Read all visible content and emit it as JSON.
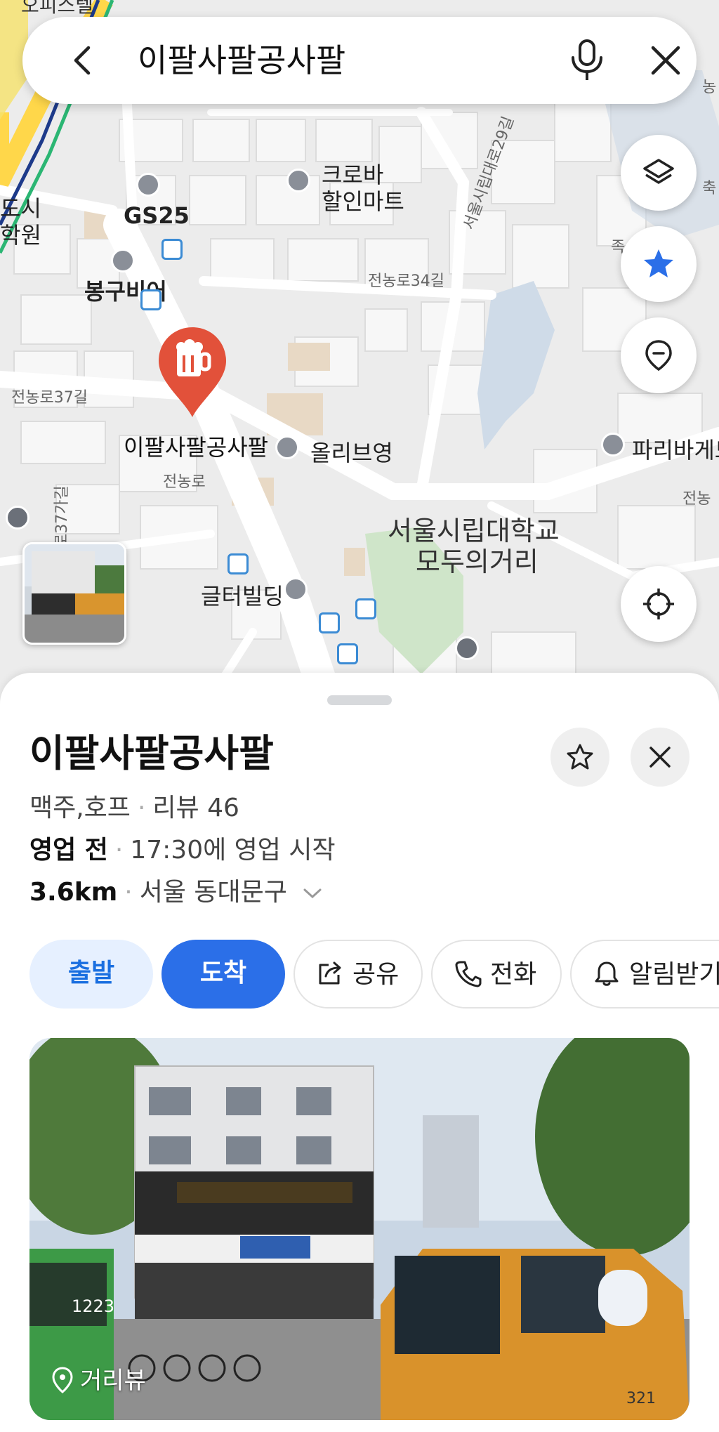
{
  "search": {
    "query": "이팔사팔공사팔"
  },
  "map": {
    "labels": {
      "officetel": "오피스텔",
      "city_left": "도시",
      "academy": "학원",
      "gs25": "GS25",
      "bonggu_beer": "봉구비어",
      "croba_mart_l1": "크로바",
      "croba_mart_l2": "할인마트",
      "jeonnong_37": "전농로37길",
      "jeonnong_34": "전농로34길",
      "seoulsirip_29": "서울시립대로29길",
      "selected_place": "이팔사팔공사팔",
      "olive_young": "올리브영",
      "paris_baguette": "파리바게드",
      "jeonnongro": "전농로",
      "jeonnong_right": "전농",
      "ro37ga": "로37가길",
      "uos_street_l1": "서울시립대학교",
      "uos_street_l2": "모두의거리",
      "gulter_building": "글터빌딩",
      "edge_ju": "족",
      "edge_chuk": "축",
      "edge_nong": "농"
    }
  },
  "place": {
    "name": "이팔사팔공사팔",
    "category": "맥주,호프",
    "reviews": "리뷰 46",
    "status": "영업 전",
    "hours": "17:30에 영업 시작",
    "distance": "3.6km",
    "region": "서울 동대문구"
  },
  "actions": {
    "start": "출발",
    "arrive": "도착",
    "share": "공유",
    "call": "전화",
    "notify": "알림받기"
  },
  "photo": {
    "streetview_label": "거리뷰",
    "bus_number": "1223",
    "truck_number": "321"
  },
  "colors": {
    "accent": "#2b6fe8",
    "pin": "#e2513a",
    "chip_light": "#e6f0ff"
  }
}
